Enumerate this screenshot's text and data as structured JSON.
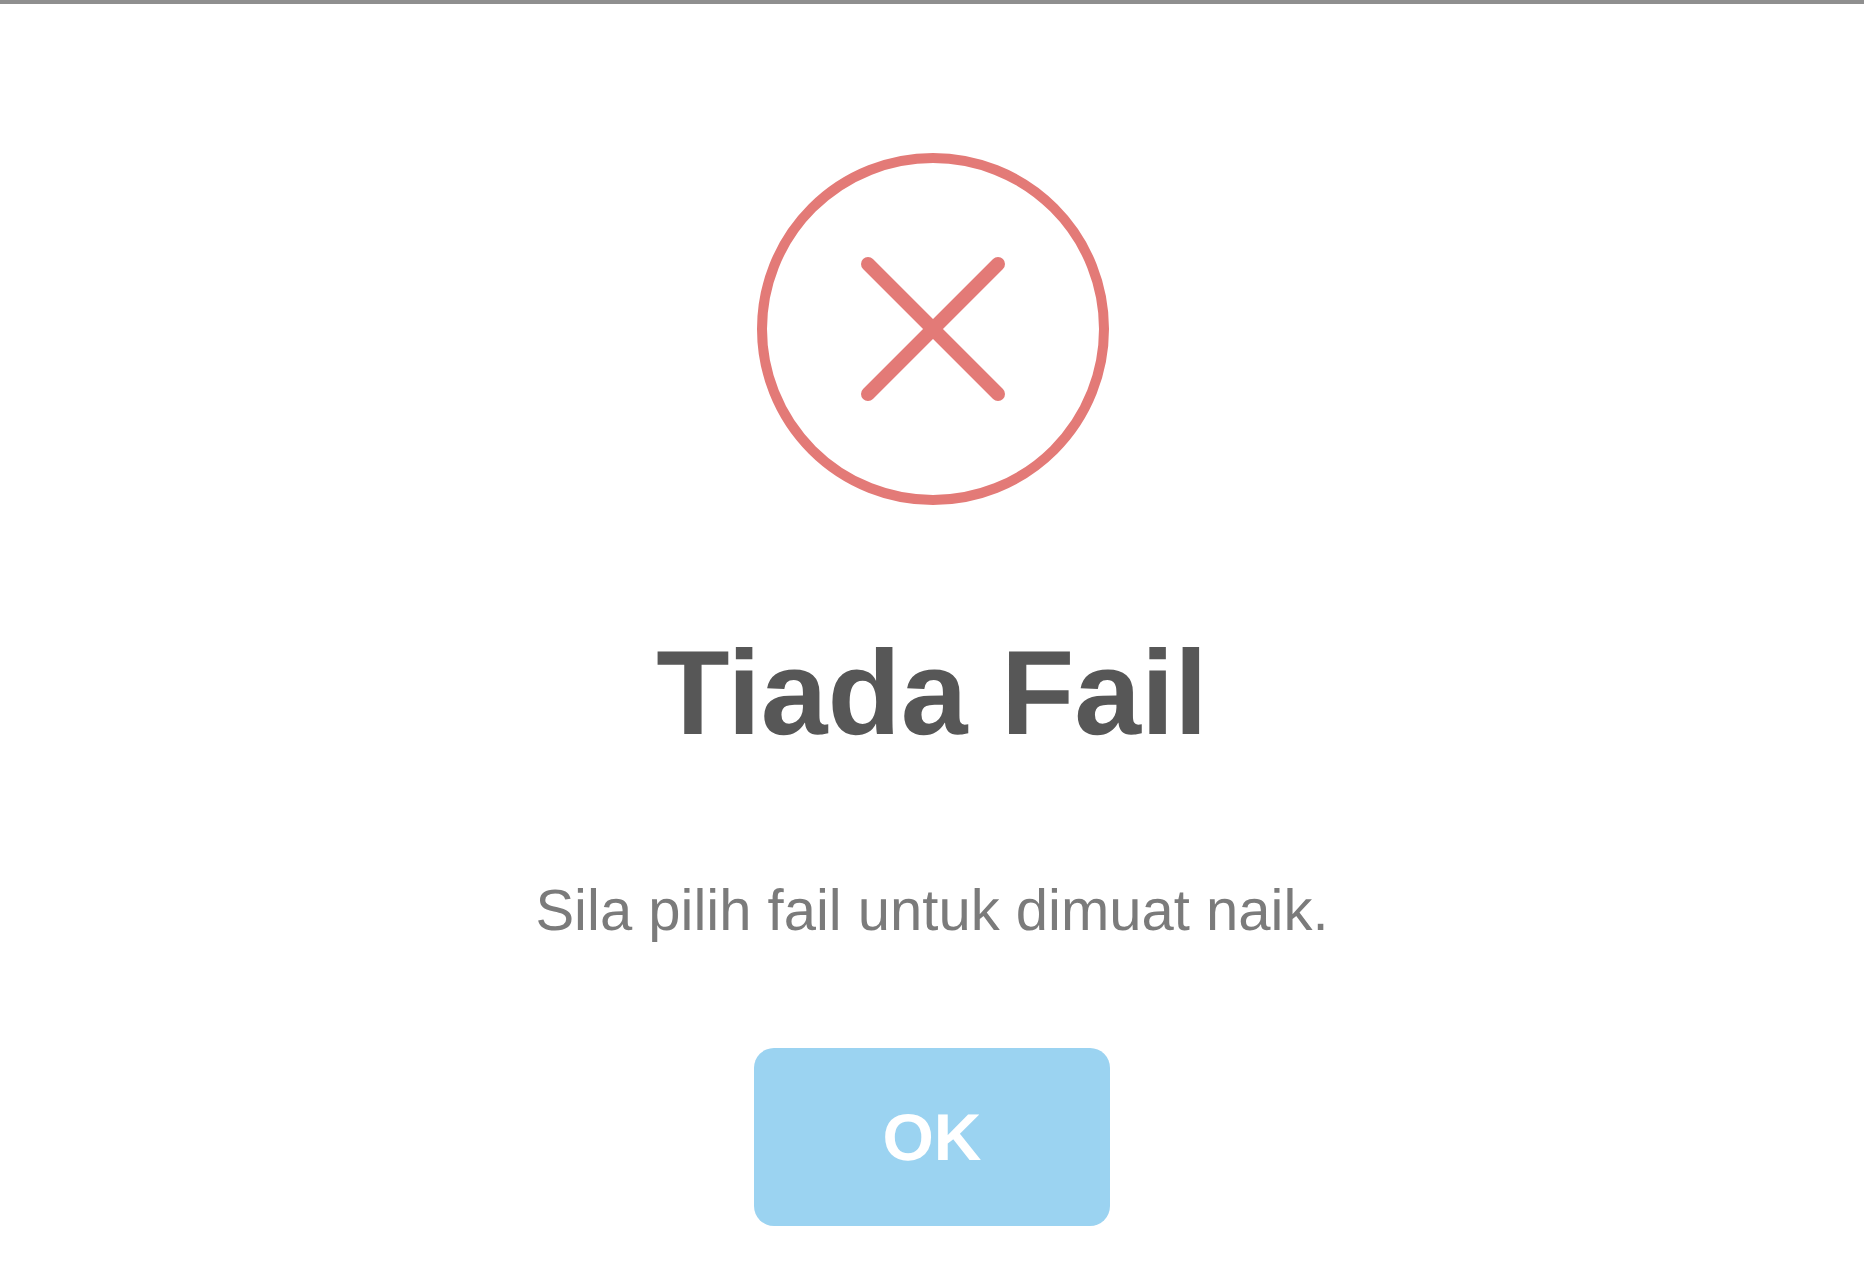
{
  "dialog": {
    "title": "Tiada Fail",
    "message": "Sila pilih fail untuk dimuat naik.",
    "buttons": [
      "OK"
    ]
  }
}
